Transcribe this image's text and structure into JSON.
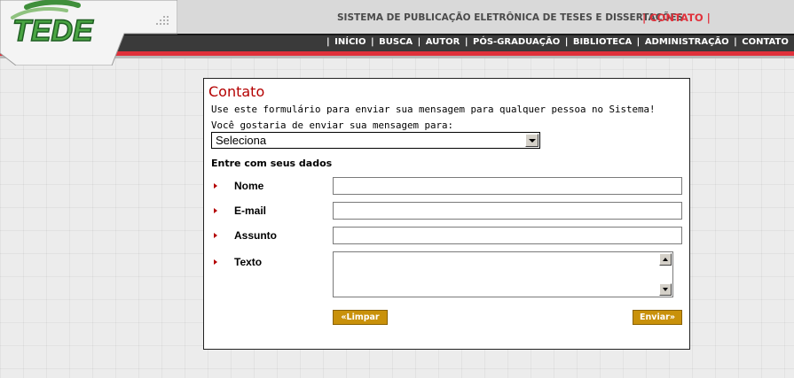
{
  "logo": {
    "text": "TEDE"
  },
  "header": {
    "system_title": "SISTEMA DE PUBLICAÇÃO ELETRÔNICA DE TESES E DISSERTAÇÕES",
    "contact_link": "| CONTATO |"
  },
  "nav": {
    "separator": "|",
    "items": [
      {
        "label": "INÍCIO"
      },
      {
        "label": "BUSCA"
      },
      {
        "label": "AUTOR"
      },
      {
        "label": "PÓS-GRADUAÇÃO"
      },
      {
        "label": "BIBLIOTECA"
      },
      {
        "label": "ADMINISTRAÇÃO"
      },
      {
        "label": "CONTATO"
      }
    ]
  },
  "form": {
    "title": "Contato",
    "intro": "Use este formulário para enviar sua mensagem para qualquer pessoa no Sistema!",
    "recipient_label": "Você gostaria de enviar sua mensagem para:",
    "recipient_selected": "Seleciona",
    "section_heading": "Entre com seus dados",
    "fields": [
      {
        "label": "Nome",
        "value": ""
      },
      {
        "label": "E-mail",
        "value": ""
      },
      {
        "label": "Assunto",
        "value": ""
      },
      {
        "label": "Texto",
        "value": ""
      }
    ],
    "clear_button": "«Limpar",
    "send_button": "Enviar»"
  },
  "colors": {
    "accent_red": "#e0313b",
    "title_red": "#b40000",
    "nav_dark": "#3a3a3a",
    "button_gold": "#c9910a",
    "logo_green": "#3f8f3b"
  }
}
